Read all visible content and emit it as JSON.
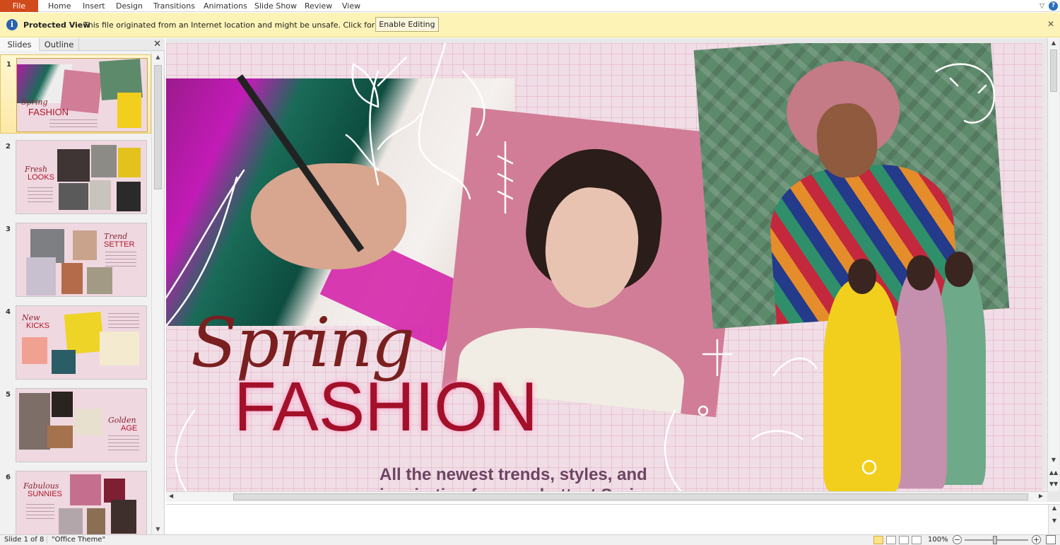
{
  "ribbon": {
    "file_label": "File",
    "tabs": [
      "Home",
      "Insert",
      "Design",
      "Transitions",
      "Animations",
      "Slide Show",
      "Review",
      "View"
    ]
  },
  "protected_view": {
    "title": "Protected View",
    "message": "This file originated from an Internet location and might be unsafe. Click for more details.",
    "button_label": "Enable Editing"
  },
  "left_pane": {
    "tabs": [
      "Slides",
      "Outline"
    ],
    "thumbnails": [
      {
        "num": "1",
        "line1": "Spring",
        "line2": "FASHION",
        "selected": true
      },
      {
        "num": "2",
        "line1": "Fresh",
        "line2": "LOOKS",
        "selected": false
      },
      {
        "num": "3",
        "line1": "Trend",
        "line2": "SETTER",
        "selected": false
      },
      {
        "num": "4",
        "line1": "New",
        "line2": "KICKS",
        "selected": false
      },
      {
        "num": "5",
        "line1": "Golden",
        "line2": "AGE",
        "selected": false
      },
      {
        "num": "6",
        "line1": "Fabulous",
        "line2": "SUNNIES",
        "selected": false
      }
    ]
  },
  "slide": {
    "title_script": "Spring",
    "title_main": "FASHION",
    "subtitle": "All the newest trends, styles, and inspiration for your hottest Spring"
  },
  "status": {
    "slide_info": "Slide 1 of 8",
    "theme": "\"Office Theme\"",
    "zoom": "100%"
  },
  "colors": {
    "file_tab": "#d14a1b",
    "protected_bar": "#fdf3b6",
    "slide_bg": "#f1dde6",
    "title_main": "#a3102a",
    "title_script": "#7a1f1f",
    "subtitle": "#6d4663"
  }
}
